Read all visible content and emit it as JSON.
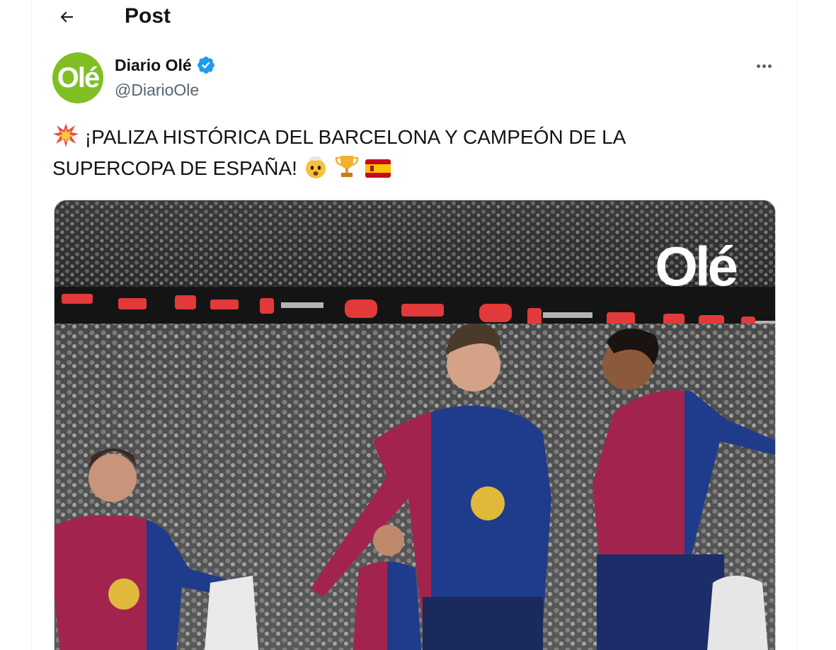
{
  "header": {
    "title": "Post",
    "back_icon": "arrow-left-icon"
  },
  "author": {
    "avatar_text": "Olé",
    "avatar_color": "#7fbf24",
    "display_name": "Diario Olé",
    "handle": "@DiarioOle",
    "verified_color": "#1d9bf0"
  },
  "tweet": {
    "line1": "¡PALIZA HISTÓRICA DEL BARCELONA Y CAMPEÓN DE LA",
    "line2": "SUPERCOPA DE ESPAÑA!",
    "leading_emoji": "collision-emoji",
    "trailing_emojis": [
      "exploding-head-emoji",
      "trophy-emoji",
      "spain-flag-emoji"
    ]
  },
  "media": {
    "watermark": "Olé",
    "description_icon": "photo-barcelona-celebration"
  }
}
